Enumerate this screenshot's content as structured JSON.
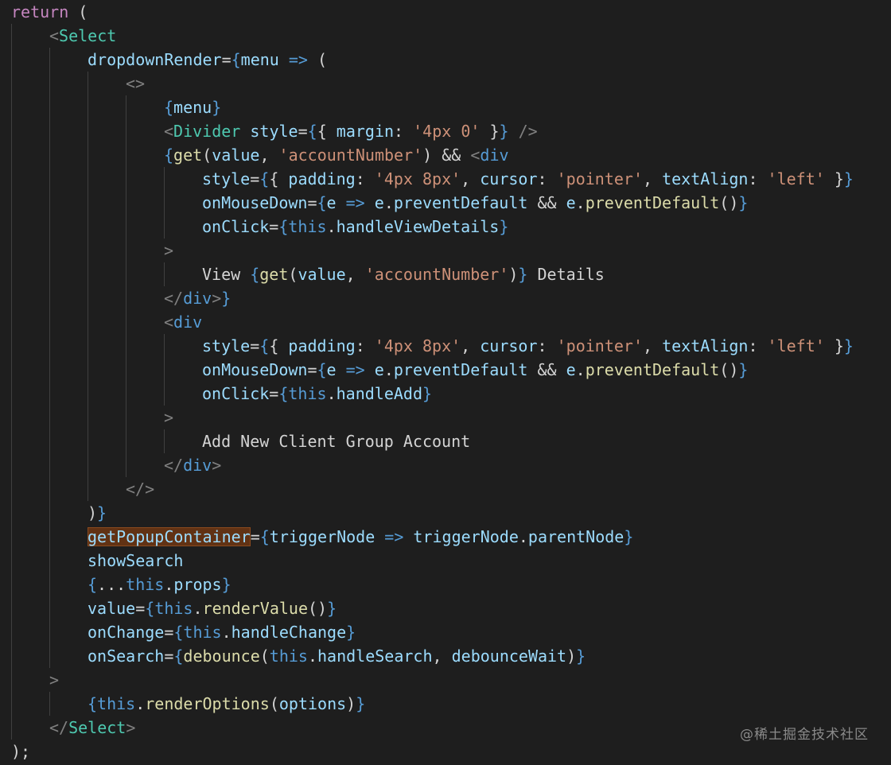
{
  "colors": {
    "background": "#1e1e1e",
    "keyword": "#c586c0",
    "punct": "#d4d4d4",
    "tag": "#4ec9b0",
    "bracket": "#808080",
    "attr": "#9cdcfe",
    "brace": "#569cd6",
    "string": "#ce9178",
    "function": "#dcdcaa",
    "plain": "#d4d4d4",
    "this": "#569cd6",
    "highlight": "#613214",
    "watermark": "#8a8a8a"
  },
  "code": {
    "lines": [
      {
        "indent": 0,
        "tokens": [
          {
            "t": "return",
            "c": "keyword"
          },
          {
            "t": " (",
            "c": "punct"
          }
        ]
      },
      {
        "indent": 1,
        "tokens": [
          {
            "t": "<",
            "c": "bracket"
          },
          {
            "t": "Select",
            "c": "tag"
          }
        ]
      },
      {
        "indent": 2,
        "tokens": [
          {
            "t": "dropdownRender",
            "c": "attr"
          },
          {
            "t": "=",
            "c": "punct"
          },
          {
            "t": "{",
            "c": "brace"
          },
          {
            "t": "menu",
            "c": "attr"
          },
          {
            "t": " => ",
            "c": "brace"
          },
          {
            "t": "(",
            "c": "punct"
          }
        ]
      },
      {
        "indent": 3,
        "tokens": [
          {
            "t": "<>",
            "c": "bracket"
          }
        ]
      },
      {
        "indent": 4,
        "tokens": [
          {
            "t": "{",
            "c": "brace"
          },
          {
            "t": "menu",
            "c": "attr"
          },
          {
            "t": "}",
            "c": "brace"
          }
        ]
      },
      {
        "indent": 4,
        "tokens": [
          {
            "t": "<",
            "c": "bracket"
          },
          {
            "t": "Divider",
            "c": "tag"
          },
          {
            "t": " ",
            "c": "plain"
          },
          {
            "t": "style",
            "c": "attr"
          },
          {
            "t": "=",
            "c": "punct"
          },
          {
            "t": "{",
            "c": "brace"
          },
          {
            "t": "{ ",
            "c": "punct"
          },
          {
            "t": "margin",
            "c": "attr"
          },
          {
            "t": ": ",
            "c": "punct"
          },
          {
            "t": "'4px 0'",
            "c": "string"
          },
          {
            "t": " }",
            "c": "punct"
          },
          {
            "t": "}",
            "c": "brace"
          },
          {
            "t": " />",
            "c": "bracket"
          }
        ]
      },
      {
        "indent": 4,
        "tokens": [
          {
            "t": "{",
            "c": "brace"
          },
          {
            "t": "get",
            "c": "function"
          },
          {
            "t": "(",
            "c": "punct"
          },
          {
            "t": "value",
            "c": "attr"
          },
          {
            "t": ", ",
            "c": "punct"
          },
          {
            "t": "'accountNumber'",
            "c": "string"
          },
          {
            "t": ") && ",
            "c": "punct"
          },
          {
            "t": "<",
            "c": "bracket"
          },
          {
            "t": "div",
            "c": "brace"
          }
        ]
      },
      {
        "indent": 5,
        "tokens": [
          {
            "t": "style",
            "c": "attr"
          },
          {
            "t": "=",
            "c": "punct"
          },
          {
            "t": "{",
            "c": "brace"
          },
          {
            "t": "{ ",
            "c": "punct"
          },
          {
            "t": "padding",
            "c": "attr"
          },
          {
            "t": ": ",
            "c": "punct"
          },
          {
            "t": "'4px 8px'",
            "c": "string"
          },
          {
            "t": ", ",
            "c": "punct"
          },
          {
            "t": "cursor",
            "c": "attr"
          },
          {
            "t": ": ",
            "c": "punct"
          },
          {
            "t": "'pointer'",
            "c": "string"
          },
          {
            "t": ", ",
            "c": "punct"
          },
          {
            "t": "textAlign",
            "c": "attr"
          },
          {
            "t": ": ",
            "c": "punct"
          },
          {
            "t": "'left'",
            "c": "string"
          },
          {
            "t": " }",
            "c": "punct"
          },
          {
            "t": "}",
            "c": "brace"
          }
        ]
      },
      {
        "indent": 5,
        "tokens": [
          {
            "t": "onMouseDown",
            "c": "attr"
          },
          {
            "t": "=",
            "c": "punct"
          },
          {
            "t": "{",
            "c": "brace"
          },
          {
            "t": "e",
            "c": "attr"
          },
          {
            "t": " => ",
            "c": "brace"
          },
          {
            "t": "e",
            "c": "attr"
          },
          {
            "t": ".",
            "c": "punct"
          },
          {
            "t": "preventDefault",
            "c": "attr"
          },
          {
            "t": " && ",
            "c": "punct"
          },
          {
            "t": "e",
            "c": "attr"
          },
          {
            "t": ".",
            "c": "punct"
          },
          {
            "t": "preventDefault",
            "c": "function"
          },
          {
            "t": "()",
            "c": "punct"
          },
          {
            "t": "}",
            "c": "brace"
          }
        ]
      },
      {
        "indent": 5,
        "tokens": [
          {
            "t": "onClick",
            "c": "attr"
          },
          {
            "t": "=",
            "c": "punct"
          },
          {
            "t": "{",
            "c": "brace"
          },
          {
            "t": "this",
            "c": "this"
          },
          {
            "t": ".",
            "c": "punct"
          },
          {
            "t": "handleViewDetails",
            "c": "attr"
          },
          {
            "t": "}",
            "c": "brace"
          }
        ]
      },
      {
        "indent": 4,
        "tokens": [
          {
            "t": ">",
            "c": "bracket"
          }
        ]
      },
      {
        "indent": 5,
        "tokens": [
          {
            "t": "View ",
            "c": "plain"
          },
          {
            "t": "{",
            "c": "brace"
          },
          {
            "t": "get",
            "c": "function"
          },
          {
            "t": "(",
            "c": "punct"
          },
          {
            "t": "value",
            "c": "attr"
          },
          {
            "t": ", ",
            "c": "punct"
          },
          {
            "t": "'accountNumber'",
            "c": "string"
          },
          {
            "t": ")",
            "c": "punct"
          },
          {
            "t": "}",
            "c": "brace"
          },
          {
            "t": " Details",
            "c": "plain"
          }
        ]
      },
      {
        "indent": 4,
        "tokens": [
          {
            "t": "</",
            "c": "bracket"
          },
          {
            "t": "div",
            "c": "brace"
          },
          {
            "t": ">",
            "c": "bracket"
          },
          {
            "t": "}",
            "c": "brace"
          }
        ]
      },
      {
        "indent": 4,
        "tokens": [
          {
            "t": "<",
            "c": "bracket"
          },
          {
            "t": "div",
            "c": "brace"
          }
        ]
      },
      {
        "indent": 5,
        "tokens": [
          {
            "t": "style",
            "c": "attr"
          },
          {
            "t": "=",
            "c": "punct"
          },
          {
            "t": "{",
            "c": "brace"
          },
          {
            "t": "{ ",
            "c": "punct"
          },
          {
            "t": "padding",
            "c": "attr"
          },
          {
            "t": ": ",
            "c": "punct"
          },
          {
            "t": "'4px 8px'",
            "c": "string"
          },
          {
            "t": ", ",
            "c": "punct"
          },
          {
            "t": "cursor",
            "c": "attr"
          },
          {
            "t": ": ",
            "c": "punct"
          },
          {
            "t": "'pointer'",
            "c": "string"
          },
          {
            "t": ", ",
            "c": "punct"
          },
          {
            "t": "textAlign",
            "c": "attr"
          },
          {
            "t": ": ",
            "c": "punct"
          },
          {
            "t": "'left'",
            "c": "string"
          },
          {
            "t": " }",
            "c": "punct"
          },
          {
            "t": "}",
            "c": "brace"
          }
        ]
      },
      {
        "indent": 5,
        "tokens": [
          {
            "t": "onMouseDown",
            "c": "attr"
          },
          {
            "t": "=",
            "c": "punct"
          },
          {
            "t": "{",
            "c": "brace"
          },
          {
            "t": "e",
            "c": "attr"
          },
          {
            "t": " => ",
            "c": "brace"
          },
          {
            "t": "e",
            "c": "attr"
          },
          {
            "t": ".",
            "c": "punct"
          },
          {
            "t": "preventDefault",
            "c": "attr"
          },
          {
            "t": " && ",
            "c": "punct"
          },
          {
            "t": "e",
            "c": "attr"
          },
          {
            "t": ".",
            "c": "punct"
          },
          {
            "t": "preventDefault",
            "c": "function"
          },
          {
            "t": "()",
            "c": "punct"
          },
          {
            "t": "}",
            "c": "brace"
          }
        ]
      },
      {
        "indent": 5,
        "tokens": [
          {
            "t": "onClick",
            "c": "attr"
          },
          {
            "t": "=",
            "c": "punct"
          },
          {
            "t": "{",
            "c": "brace"
          },
          {
            "t": "this",
            "c": "this"
          },
          {
            "t": ".",
            "c": "punct"
          },
          {
            "t": "handleAdd",
            "c": "attr"
          },
          {
            "t": "}",
            "c": "brace"
          }
        ]
      },
      {
        "indent": 4,
        "tokens": [
          {
            "t": ">",
            "c": "bracket"
          }
        ]
      },
      {
        "indent": 5,
        "tokens": [
          {
            "t": "Add New Client Group Account",
            "c": "plain"
          }
        ]
      },
      {
        "indent": 4,
        "tokens": [
          {
            "t": "</",
            "c": "bracket"
          },
          {
            "t": "div",
            "c": "brace"
          },
          {
            "t": ">",
            "c": "bracket"
          }
        ]
      },
      {
        "indent": 3,
        "tokens": [
          {
            "t": "</>",
            "c": "bracket"
          }
        ]
      },
      {
        "indent": 2,
        "tokens": [
          {
            "t": ")",
            "c": "punct"
          },
          {
            "t": "}",
            "c": "brace"
          }
        ]
      },
      {
        "indent": 2,
        "tokens": [
          {
            "t": "getPopupContainer",
            "c": "attr",
            "hl": true
          },
          {
            "t": "=",
            "c": "punct"
          },
          {
            "t": "{",
            "c": "brace"
          },
          {
            "t": "triggerNode",
            "c": "attr"
          },
          {
            "t": " => ",
            "c": "brace"
          },
          {
            "t": "triggerNode",
            "c": "attr"
          },
          {
            "t": ".",
            "c": "punct"
          },
          {
            "t": "parentNode",
            "c": "attr"
          },
          {
            "t": "}",
            "c": "brace"
          }
        ]
      },
      {
        "indent": 2,
        "tokens": [
          {
            "t": "showSearch",
            "c": "attr"
          }
        ]
      },
      {
        "indent": 2,
        "tokens": [
          {
            "t": "{",
            "c": "brace"
          },
          {
            "t": "...",
            "c": "punct"
          },
          {
            "t": "this",
            "c": "this"
          },
          {
            "t": ".",
            "c": "punct"
          },
          {
            "t": "props",
            "c": "attr"
          },
          {
            "t": "}",
            "c": "brace"
          }
        ]
      },
      {
        "indent": 2,
        "tokens": [
          {
            "t": "value",
            "c": "attr"
          },
          {
            "t": "=",
            "c": "punct"
          },
          {
            "t": "{",
            "c": "brace"
          },
          {
            "t": "this",
            "c": "this"
          },
          {
            "t": ".",
            "c": "punct"
          },
          {
            "t": "renderValue",
            "c": "function"
          },
          {
            "t": "()",
            "c": "punct"
          },
          {
            "t": "}",
            "c": "brace"
          }
        ]
      },
      {
        "indent": 2,
        "tokens": [
          {
            "t": "onChange",
            "c": "attr"
          },
          {
            "t": "=",
            "c": "punct"
          },
          {
            "t": "{",
            "c": "brace"
          },
          {
            "t": "this",
            "c": "this"
          },
          {
            "t": ".",
            "c": "punct"
          },
          {
            "t": "handleChange",
            "c": "attr"
          },
          {
            "t": "}",
            "c": "brace"
          }
        ]
      },
      {
        "indent": 2,
        "tokens": [
          {
            "t": "onSearch",
            "c": "attr"
          },
          {
            "t": "=",
            "c": "punct"
          },
          {
            "t": "{",
            "c": "brace"
          },
          {
            "t": "debounce",
            "c": "function"
          },
          {
            "t": "(",
            "c": "punct"
          },
          {
            "t": "this",
            "c": "this"
          },
          {
            "t": ".",
            "c": "punct"
          },
          {
            "t": "handleSearch",
            "c": "attr"
          },
          {
            "t": ", ",
            "c": "punct"
          },
          {
            "t": "debounceWait",
            "c": "attr"
          },
          {
            "t": ")",
            "c": "punct"
          },
          {
            "t": "}",
            "c": "brace"
          }
        ]
      },
      {
        "indent": 1,
        "tokens": [
          {
            "t": ">",
            "c": "bracket"
          }
        ]
      },
      {
        "indent": 2,
        "tokens": [
          {
            "t": "{",
            "c": "brace"
          },
          {
            "t": "this",
            "c": "this"
          },
          {
            "t": ".",
            "c": "punct"
          },
          {
            "t": "renderOptions",
            "c": "function"
          },
          {
            "t": "(",
            "c": "punct"
          },
          {
            "t": "options",
            "c": "attr"
          },
          {
            "t": ")",
            "c": "punct"
          },
          {
            "t": "}",
            "c": "brace"
          }
        ]
      },
      {
        "indent": 1,
        "tokens": [
          {
            "t": "</",
            "c": "bracket"
          },
          {
            "t": "Select",
            "c": "tag"
          },
          {
            "t": ">",
            "c": "bracket"
          }
        ]
      },
      {
        "indent": 0,
        "tokens": [
          {
            "t": ");",
            "c": "punct"
          }
        ]
      }
    ]
  },
  "watermark": {
    "text": "@稀土掘金技术社区"
  }
}
